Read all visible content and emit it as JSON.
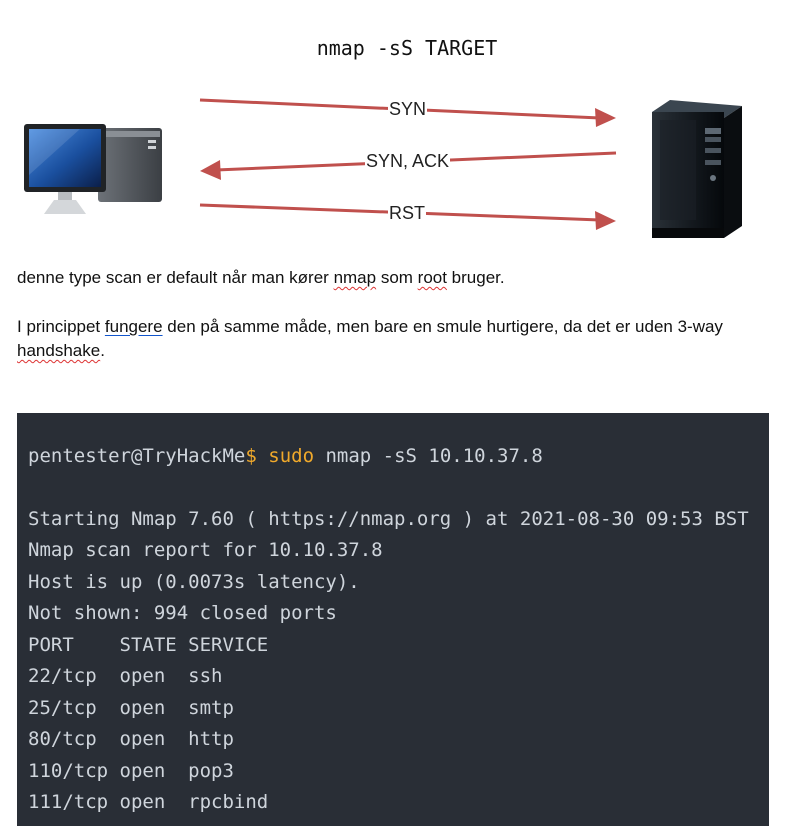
{
  "diagram": {
    "title": "nmap -sS TARGET",
    "arrows": [
      {
        "label": "SYN",
        "direction": "right"
      },
      {
        "label": "SYN, ACK",
        "direction": "left"
      },
      {
        "label": "RST",
        "direction": "right"
      }
    ],
    "arrow_color": "#c0504d",
    "client_icon": "desktop-computer-icon",
    "server_icon": "server-tower-icon"
  },
  "paragraph1": {
    "before": "denne type scan er default når man kører ",
    "word1": "nmap",
    "between": " som ",
    "word2": "root",
    "after": " bruger."
  },
  "paragraph2": {
    "before": "I princippet ",
    "link": "fungere",
    "middle": " den på samme måde, men bare en smule hurtigere, da det er uden 3-way ",
    "word": "handshake",
    "after": "."
  },
  "terminal": {
    "prompt": "pentester@TryHackMe",
    "prompt_symbol": "$",
    "sudo": "sudo",
    "command": " nmap -sS 10.10.37.8",
    "lines": [
      "Starting Nmap 7.60 ( https://nmap.org ) at 2021-08-30 09:53 BST",
      "Nmap scan report for 10.10.37.8",
      "Host is up (0.0073s latency).",
      "Not shown: 994 closed ports",
      "PORT    STATE SERVICE",
      "22/tcp  open  ssh",
      "25/tcp  open  smtp",
      "80/tcp  open  http",
      "110/tcp open  pop3",
      "111/tcp open  rpcbind"
    ],
    "background": "#292e36",
    "accent": "#f0a92b"
  }
}
